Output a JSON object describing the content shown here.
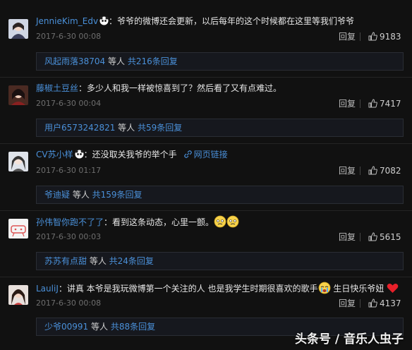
{
  "comments": [
    {
      "user": "JennieKim_Edv",
      "text": "：爷爷的微博还会更新，以后每年的这个时候都在这里等我们爷爷",
      "date": "2017-6-30 00:08",
      "reply_label": "回复",
      "likes": "9183",
      "sub_user": "风起雨落38704",
      "sub_mid": " 等人 ",
      "sub_count": "共216条回复"
    },
    {
      "user": "藤椒土豆丝",
      "text": "：多少人和我一样被惊喜到了？然后看了又有点难过。",
      "date": "2017-6-30 00:04",
      "reply_label": "回复",
      "likes": "7417",
      "sub_user": "用户6573242821",
      "sub_mid": " 等人 ",
      "sub_count": "共59条回复"
    },
    {
      "user": "CV苏小样",
      "text": "：还没取关我爷的举个手",
      "link": "网页链接",
      "date": "2017-6-30 01:17",
      "reply_label": "回复",
      "likes": "7082",
      "sub_user": "爷迪疑",
      "sub_mid": " 等人 ",
      "sub_count": "共159条回复"
    },
    {
      "user": "孙伟智你跑不了了",
      "text": "：看到这条动态，心里一颤。",
      "date": "2017-6-30 00:03",
      "reply_label": "回复",
      "likes": "5615",
      "sub_user": "苏苏有点甜",
      "sub_mid": " 等人 ",
      "sub_count": "共24条回复"
    },
    {
      "user": "LauliJ",
      "text": "：讲真 本爷是我玩微博第一个关注的人 也是我学生时期很喜欢的歌手",
      "text2": " 生日快乐爷妞 ",
      "date": "2017-6-30 00:08",
      "reply_label": "回复",
      "likes": "4137",
      "sub_user": "少爷00991",
      "sub_mid": " 等人 ",
      "sub_count": "共88条回复"
    }
  ],
  "watermark": "头条号 / 音乐人虫子",
  "colors": {
    "background": "#111111",
    "link": "#4a90d9",
    "muted": "#6e6e6e"
  }
}
